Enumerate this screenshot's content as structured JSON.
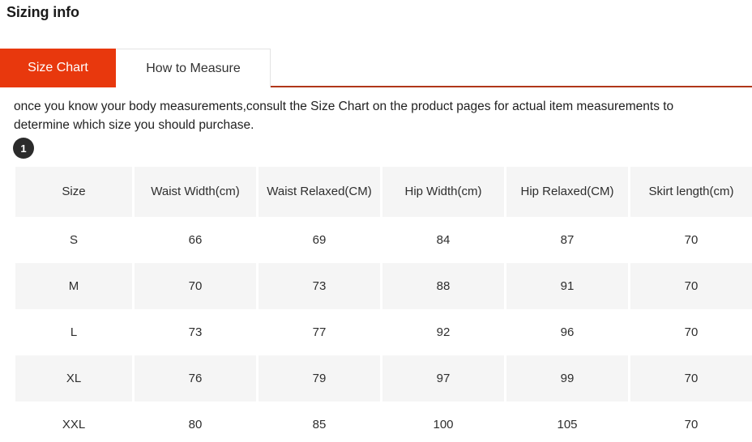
{
  "page_title": "Sizing info",
  "tabs": [
    {
      "label": "Size Chart",
      "active": true
    },
    {
      "label": "How to Measure",
      "active": false
    }
  ],
  "description": "once you know your body measurements,consult the Size Chart on the product pages for actual item measurements to determine which size you should purchase.",
  "badge": {
    "number": "1"
  },
  "colors": {
    "accent_red": "#e8380d",
    "tab_underline": "#b0371a",
    "row_alt_background": "#f5f5f5",
    "header_background": "#f5f5f5",
    "badge_background": "#2b2b2b"
  },
  "table": {
    "headers": [
      "Size",
      "Waist Width(cm)",
      "Waist Relaxed(CM)",
      "Hip Width(cm)",
      "Hip Relaxed(CM)",
      "Skirt length(cm)"
    ],
    "rows": [
      [
        "S",
        "66",
        "69",
        "84",
        "87",
        "70"
      ],
      [
        "M",
        "70",
        "73",
        "88",
        "91",
        "70"
      ],
      [
        "L",
        "73",
        "77",
        "92",
        "96",
        "70"
      ],
      [
        "XL",
        "76",
        "79",
        "97",
        "99",
        "70"
      ],
      [
        "XXL",
        "80",
        "85",
        "100",
        "105",
        "70"
      ]
    ]
  }
}
